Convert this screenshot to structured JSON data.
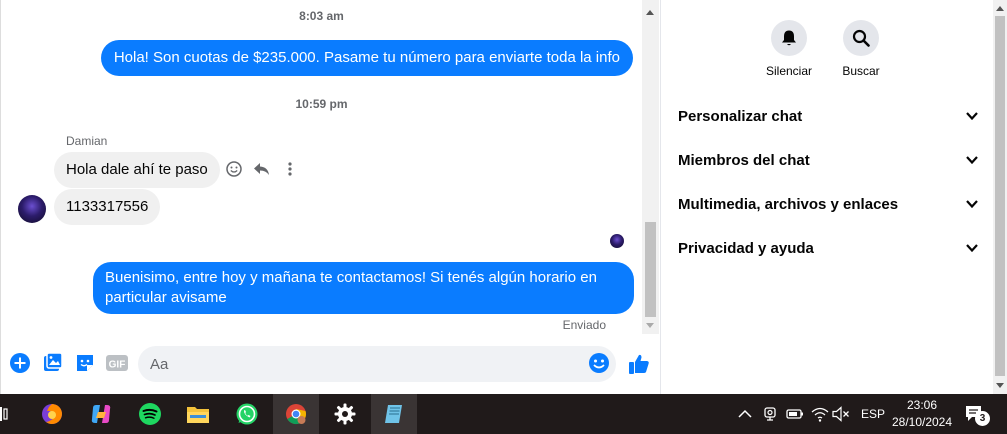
{
  "chat": {
    "messages": [
      {
        "type": "timestamp",
        "text": "8:03 am"
      },
      {
        "type": "outgoing",
        "text": "Hola! Son cuotas de $235.000. Pasame tu número para enviarte toda la info"
      },
      {
        "type": "timestamp",
        "text": "10:59 pm"
      },
      {
        "type": "sender",
        "text": "Damian"
      },
      {
        "type": "incoming",
        "text": "Hola dale ahí te paso"
      },
      {
        "type": "incoming",
        "text": "1133317556"
      },
      {
        "type": "outgoing",
        "text": "Buenisimo, entre hoy y mañana te contactamos! Si tenés algún horario en particular avisame"
      }
    ],
    "status": "Enviado"
  },
  "composer": {
    "placeholder": "Aa",
    "icons": [
      "plus-icon",
      "image-icon",
      "sticker-icon",
      "gif-icon",
      "emoji-icon",
      "like-icon"
    ],
    "gif_label": "GIF"
  },
  "info": {
    "actions": [
      {
        "label": "Silenciar",
        "icon": "bell-icon"
      },
      {
        "label": "Buscar",
        "icon": "search-icon"
      }
    ],
    "sections": [
      {
        "label": "Personalizar chat"
      },
      {
        "label": "Miembros del chat"
      },
      {
        "label": "Multimedia, archivos y enlaces"
      },
      {
        "label": "Privacidad y ayuda"
      }
    ]
  },
  "taskbar": {
    "apps": [
      "task-view-icon",
      "firefox-icon",
      "copilot-icon",
      "spotify-icon",
      "file-explorer-icon",
      "whatsapp-icon",
      "chrome-icon",
      "settings-icon",
      "notepad-icon"
    ],
    "language": "ESP",
    "time": "23:06",
    "date": "28/10/2024",
    "notification_count": "3"
  },
  "colors": {
    "accent": "#0a7cff",
    "incoming_bubble": "#f0f0f0",
    "taskbar": "#201a1a"
  }
}
